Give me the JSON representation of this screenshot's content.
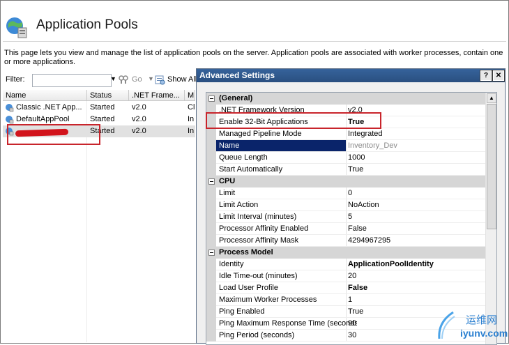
{
  "page": {
    "title": "Application Pools",
    "description": "This page lets you view and manage the list of application pools on the server. Application pools are associated with worker processes, contain one or more applications."
  },
  "toolbar": {
    "filter_label": "Filter:",
    "filter_value": "",
    "go_label": "Go",
    "show_all_label": "Show All"
  },
  "grid": {
    "columns": [
      "Name",
      "Status",
      ".NET Frame...",
      "M"
    ],
    "rows": [
      {
        "name": "Classic .NET App...",
        "status": "Started",
        "framework": "v2.0",
        "mode": "Cl"
      },
      {
        "name": "DefaultAppPool",
        "status": "Started",
        "framework": "v2.0",
        "mode": "In"
      },
      {
        "name": "",
        "status": "Started",
        "framework": "v2.0",
        "mode": "In"
      }
    ]
  },
  "dialog": {
    "title": "Advanced Settings",
    "help_label": "?",
    "close_label": "✕",
    "rows": [
      {
        "type": "category",
        "name": "(General)"
      },
      {
        "type": "prop",
        "name": ".NET Framework Version",
        "value": "v2.0",
        "bold": false
      },
      {
        "type": "prop",
        "name": "Enable 32-Bit Applications",
        "value": "True",
        "bold": true
      },
      {
        "type": "prop",
        "name": "Managed Pipeline Mode",
        "value": "Integrated",
        "bold": false
      },
      {
        "type": "prop",
        "name": "Name",
        "value": "Inventory_Dev",
        "bold": false,
        "selected": true
      },
      {
        "type": "prop",
        "name": "Queue Length",
        "value": "1000",
        "bold": false
      },
      {
        "type": "prop",
        "name": "Start Automatically",
        "value": "True",
        "bold": false
      },
      {
        "type": "category",
        "name": "CPU"
      },
      {
        "type": "prop",
        "name": "Limit",
        "value": "0",
        "bold": false
      },
      {
        "type": "prop",
        "name": "Limit Action",
        "value": "NoAction",
        "bold": false
      },
      {
        "type": "prop",
        "name": "Limit Interval (minutes)",
        "value": "5",
        "bold": false
      },
      {
        "type": "prop",
        "name": "Processor Affinity Enabled",
        "value": "False",
        "bold": false
      },
      {
        "type": "prop",
        "name": "Processor Affinity Mask",
        "value": "4294967295",
        "bold": false
      },
      {
        "type": "category",
        "name": "Process Model"
      },
      {
        "type": "prop",
        "name": "Identity",
        "value": "ApplicationPoolIdentity",
        "bold": true
      },
      {
        "type": "prop",
        "name": "Idle Time-out (minutes)",
        "value": "20",
        "bold": false
      },
      {
        "type": "prop",
        "name": "Load User Profile",
        "value": "False",
        "bold": true
      },
      {
        "type": "prop",
        "name": "Maximum Worker Processes",
        "value": "1",
        "bold": false
      },
      {
        "type": "prop",
        "name": "Ping Enabled",
        "value": "True",
        "bold": false
      },
      {
        "type": "prop",
        "name": "Ping Maximum Response Time (seconds)",
        "value": "90",
        "bold": false
      },
      {
        "type": "prop",
        "name": "Ping Period (seconds)",
        "value": "30",
        "bold": false
      }
    ]
  },
  "watermark": {
    "cn": "运维网",
    "en": "iyunv.com"
  },
  "colors": {
    "title_bar": "#2f5a8f",
    "selection": "#0a246a",
    "annotation_red": "#c8242b"
  }
}
